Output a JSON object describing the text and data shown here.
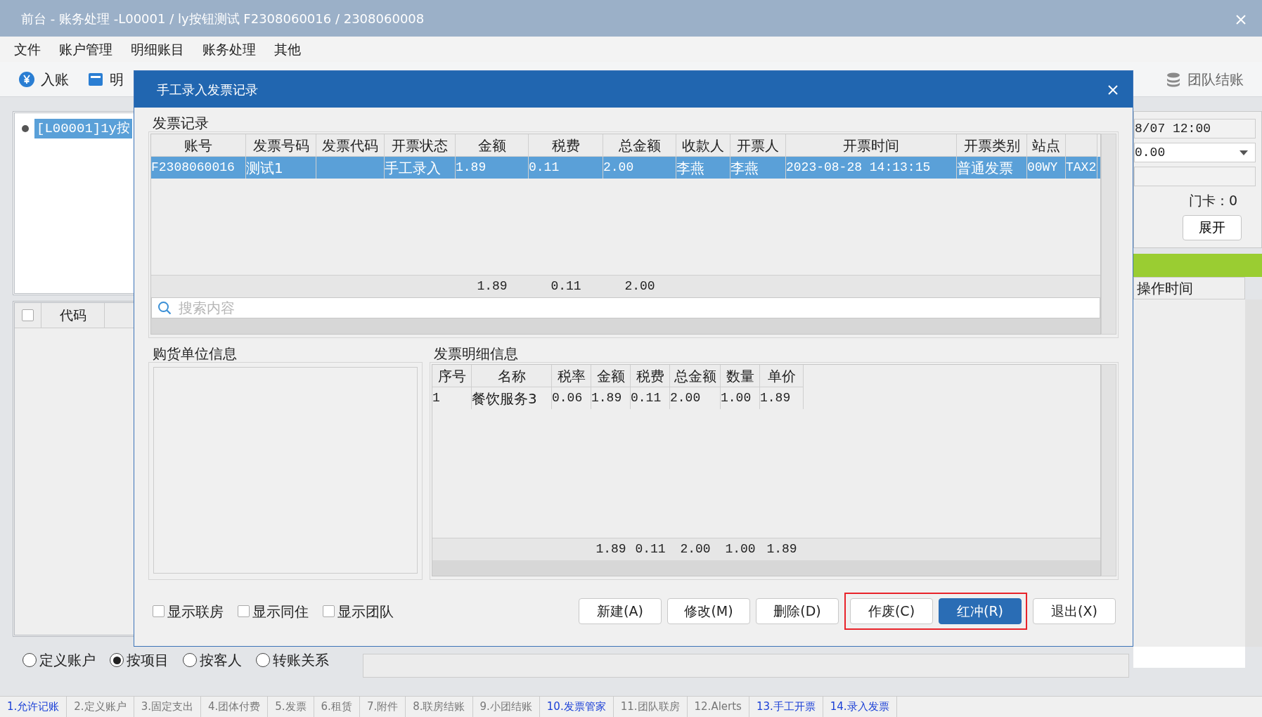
{
  "window": {
    "title": "前台 - 账务处理 -L00001 / ly按钮测试  F2308060016 / 2308060008"
  },
  "menu": [
    "文件",
    "账户管理",
    "明细账目",
    "账务处理",
    "其他"
  ],
  "toolbar": [
    "入账",
    "明"
  ],
  "toolbar_right": "团队结账",
  "tree": [
    {
      "label": "[L00001]1y按",
      "selected": true
    }
  ],
  "account_list": {
    "select_all_checked": false,
    "columns": [
      "代码"
    ]
  },
  "account_filter": [
    {
      "label": "定义账户",
      "selected": false
    },
    {
      "label": "按项目",
      "selected": true
    },
    {
      "label": "按客人",
      "selected": false
    },
    {
      "label": "转账关系",
      "selected": false
    }
  ],
  "right_panel": {
    "time": "8/07 12:00",
    "amount": "0.00",
    "door_card": "门卡：0",
    "expand_button": "展开",
    "log_columns": [
      "操作时间"
    ]
  },
  "bottom_tabs": [
    {
      "label": "1.允许记账",
      "highlighted": true
    },
    {
      "label": "2.定义账户",
      "highlighted": false
    },
    {
      "label": "3.固定支出",
      "highlighted": false
    },
    {
      "label": "4.团体付费",
      "highlighted": false
    },
    {
      "label": "5.发票",
      "highlighted": false
    },
    {
      "label": "6.租赁",
      "highlighted": false
    },
    {
      "label": "7.附件",
      "highlighted": false
    },
    {
      "label": "8.联房结账",
      "highlighted": false
    },
    {
      "label": "9.小团结账",
      "highlighted": false
    },
    {
      "label": "10.发票管家",
      "highlighted": true
    },
    {
      "label": "11.团队联房",
      "highlighted": false
    },
    {
      "label": "12.Alerts",
      "highlighted": false
    },
    {
      "label": "13.手工开票",
      "highlighted": true
    },
    {
      "label": "14.录入发票",
      "highlighted": true
    }
  ],
  "dialog": {
    "title": "手工录入发票记录",
    "invoice_records": {
      "title": "发票记录",
      "rows": [
        {
          "selected": true
        }
      ],
      "columns": [
        {
          "label": "账号",
          "cells": [
            "F2308060016"
          ]
        },
        {
          "label": "发票号码",
          "cells": [
            "测试1"
          ]
        },
        {
          "label": "发票代码"
        },
        {
          "label": "开票状态",
          "cells": [
            "手工录入"
          ]
        },
        {
          "label": "金额",
          "cells": [
            "1.89"
          ],
          "total": "1.89"
        },
        {
          "label": "税费",
          "cells": [
            "0.11"
          ],
          "total": "0.11"
        },
        {
          "label": "总金额",
          "cells": [
            "2.00"
          ],
          "total": "2.00"
        },
        {
          "label": "收款人",
          "cells": [
            "李燕"
          ]
        },
        {
          "label": "开票人",
          "cells": [
            "李燕"
          ]
        },
        {
          "label": "开票时间",
          "cells": [
            "2023-08-28 14:13:15"
          ]
        },
        {
          "label": "开票类别",
          "cells": [
            "普通发票"
          ]
        },
        {
          "label": "站点",
          "cells": [
            "00WY"
          ]
        },
        {
          "cells": [
            "TAX2"
          ]
        }
      ],
      "search": {
        "placeholder": "搜索内容"
      }
    },
    "buyer_info": {
      "title": "购货单位信息"
    },
    "invoice_details": {
      "title": "发票明细信息",
      "columns": [
        {
          "label": "序号",
          "cells": [
            "1"
          ]
        },
        {
          "label": "名称",
          "cells": [
            "餐饮服务3"
          ]
        },
        {
          "label": "税率",
          "cells": [
            "0.06"
          ]
        },
        {
          "label": "金额",
          "cells": [
            "1.89"
          ],
          "total": "1.89"
        },
        {
          "label": "税费",
          "cells": [
            "0.11"
          ],
          "total": "0.11"
        },
        {
          "label": "总金额",
          "cells": [
            "2.00"
          ],
          "total": "2.00"
        },
        {
          "label": "数量",
          "cells": [
            "1.00"
          ],
          "total": "1.00"
        },
        {
          "label": "单价",
          "cells": [
            "1.89"
          ],
          "total": "1.89"
        }
      ]
    },
    "checkboxes": [
      {
        "label": "显示联房",
        "checked": false
      },
      {
        "label": "显示同住",
        "checked": false
      },
      {
        "label": "显示团队",
        "checked": false
      }
    ],
    "buttons": [
      {
        "label": "新建(A)",
        "primary": false,
        "marked": false
      },
      {
        "label": "修改(M)",
        "primary": false,
        "marked": false
      },
      {
        "label": "删除(D)",
        "primary": false,
        "marked": false
      },
      {
        "label": "作废(C)",
        "primary": false,
        "marked": true
      },
      {
        "label": "红冲(R)",
        "primary": true,
        "marked": true
      },
      {
        "label": "退出(X)",
        "primary": false,
        "marked": false
      }
    ]
  }
}
